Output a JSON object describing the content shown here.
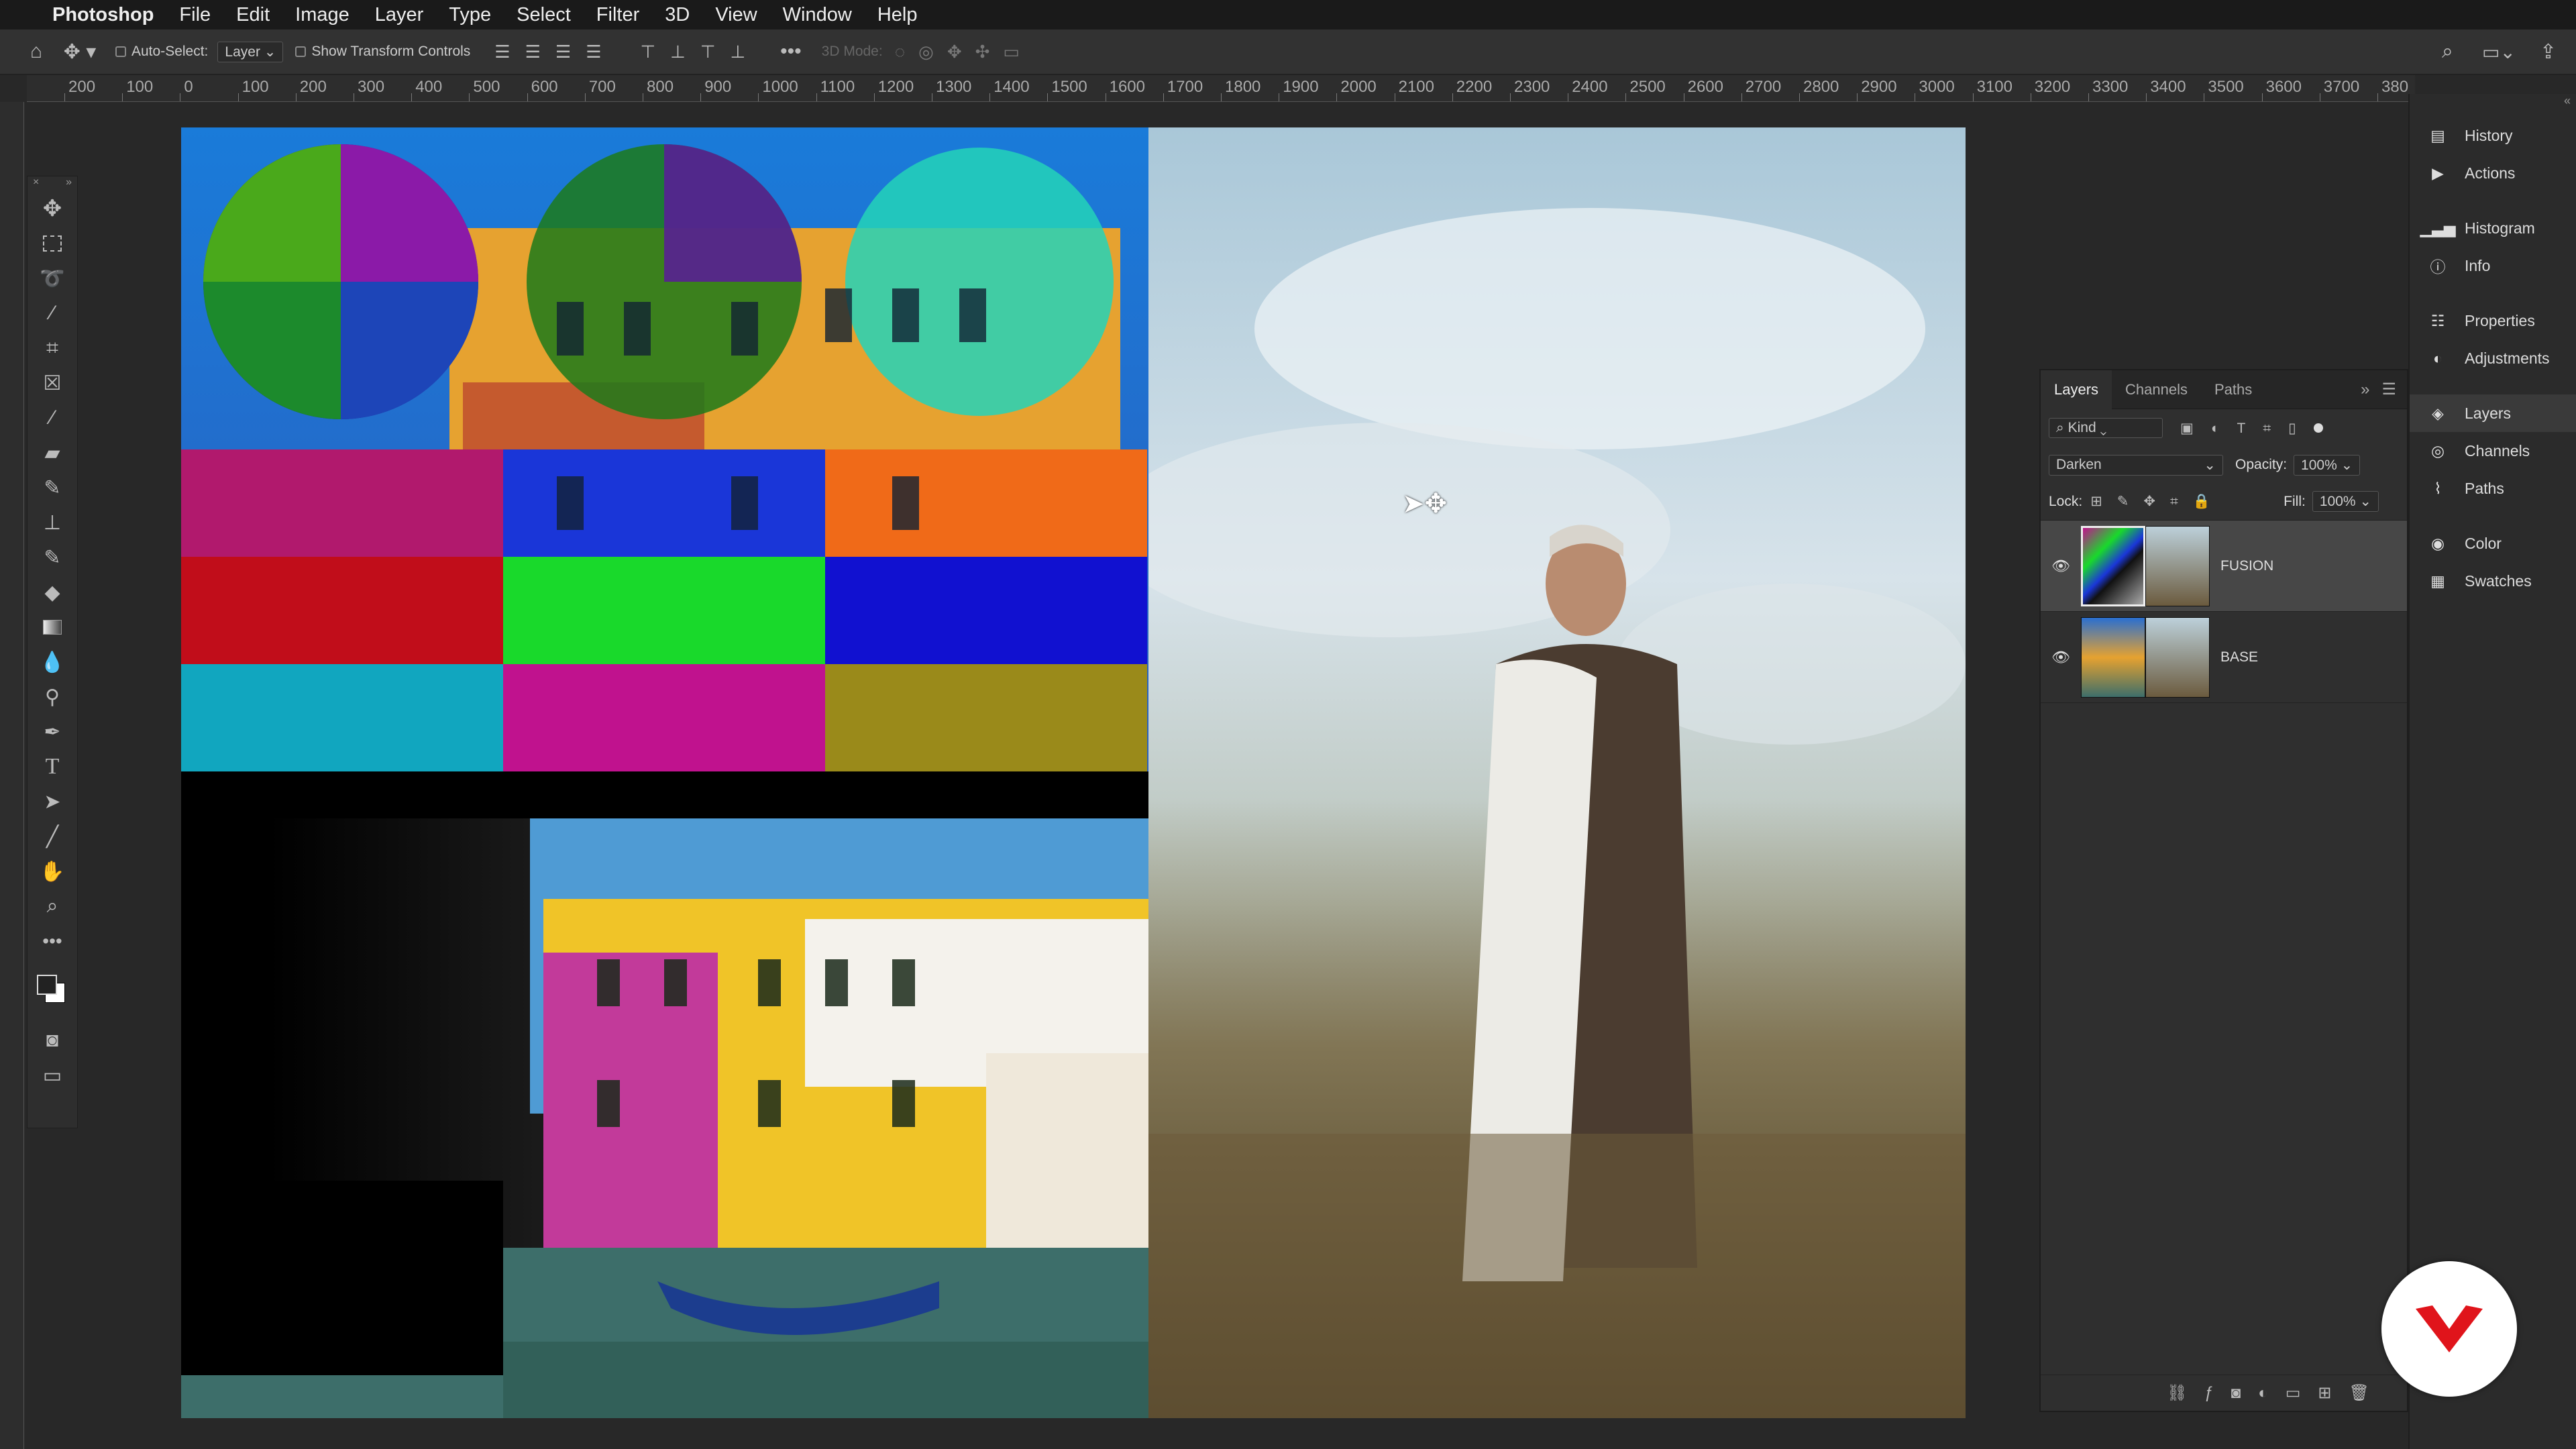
{
  "menubar": {
    "app_name": "Photoshop",
    "items": [
      "File",
      "Edit",
      "Image",
      "Layer",
      "Type",
      "Select",
      "Filter",
      "3D",
      "View",
      "Window",
      "Help"
    ]
  },
  "options_bar": {
    "auto_select_label": "Auto-Select:",
    "auto_select_value": "Layer",
    "transform_label": "Show Transform Controls",
    "mode_label": "3D Mode:"
  },
  "ruler": {
    "labels": [
      "200",
      "100",
      "0",
      "100",
      "200",
      "300",
      "400",
      "500",
      "600",
      "700",
      "800",
      "900",
      "1000",
      "1100",
      "1200",
      "1300",
      "1400",
      "1500",
      "1600",
      "1700",
      "1800",
      "1900",
      "2000",
      "2100",
      "2200",
      "2300",
      "2400",
      "2500",
      "2600",
      "2700",
      "2800",
      "2900",
      "3000",
      "3100",
      "3200",
      "3300",
      "3400",
      "3500",
      "3600",
      "3700",
      "380"
    ]
  },
  "right_dock": {
    "items": [
      {
        "label": "History",
        "icon": "history-icon"
      },
      {
        "label": "Actions",
        "icon": "play-icon"
      },
      {
        "label": "Histogram",
        "icon": "histogram-icon"
      },
      {
        "label": "Info",
        "icon": "info-icon"
      },
      {
        "label": "Properties",
        "icon": "properties-icon"
      },
      {
        "label": "Adjustments",
        "icon": "adjustments-icon"
      },
      {
        "label": "Layers",
        "icon": "layers-icon"
      },
      {
        "label": "Channels",
        "icon": "channels-icon"
      },
      {
        "label": "Paths",
        "icon": "paths-icon"
      },
      {
        "label": "Color",
        "icon": "color-icon"
      },
      {
        "label": "Swatches",
        "icon": "swatches-icon"
      }
    ]
  },
  "layers_panel": {
    "tabs": [
      "Layers",
      "Channels",
      "Paths"
    ],
    "filter_kind": "Kind",
    "blend_mode": "Darken",
    "opacity_label": "Opacity:",
    "opacity_value": "100%",
    "lock_label": "Lock:",
    "fill_label": "Fill:",
    "fill_value": "100%",
    "layers": [
      {
        "name": "FUSION"
      },
      {
        "name": "BASE"
      }
    ]
  },
  "colors": {
    "accent_logo": "#e0141b",
    "panel_bg": "#2f2f2f",
    "selected_layer": "#474747"
  }
}
